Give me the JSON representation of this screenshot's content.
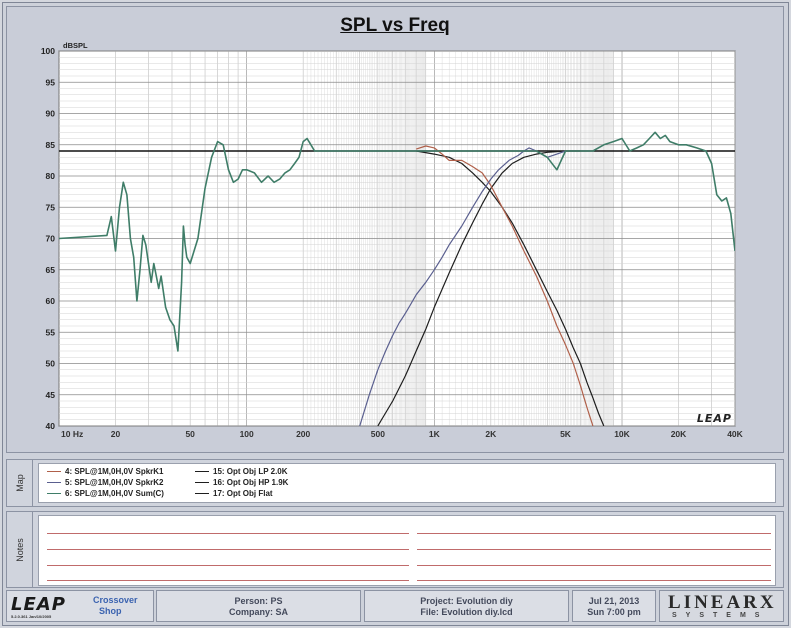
{
  "chart_data": {
    "type": "line",
    "title": "SPL vs Freq",
    "ylabel": "dBSPL",
    "xscale": "log",
    "xlim": [
      10,
      40000
    ],
    "ylim": [
      40,
      100
    ],
    "grid": true,
    "y_ticks": [
      100,
      95,
      90,
      85,
      80,
      75,
      70,
      65,
      60,
      55,
      50,
      45,
      40
    ],
    "x_ticks": [
      {
        "value": 10,
        "label": "10  Hz"
      },
      {
        "value": 20,
        "label": "20"
      },
      {
        "value": 50,
        "label": "50"
      },
      {
        "value": 100,
        "label": "100"
      },
      {
        "value": 200,
        "label": "200"
      },
      {
        "value": 500,
        "label": "500"
      },
      {
        "value": 1000,
        "label": "1K"
      },
      {
        "value": 2000,
        "label": "2K"
      },
      {
        "value": 5000,
        "label": "5K"
      },
      {
        "value": 10000,
        "label": "10K"
      },
      {
        "value": 20000,
        "label": "20K"
      },
      {
        "value": 40000,
        "label": "40K"
      }
    ],
    "reference_line": 84,
    "watermark": "LEAP",
    "series": [
      {
        "name": "4: SPL@1M,0H,0V SpkrK1",
        "color": "#b0604a",
        "x": [
          800,
          900,
          1000,
          1100,
          1200,
          1400,
          1600,
          1800,
          2000,
          2300,
          2600,
          3000,
          3500,
          4000,
          4500,
          5000,
          5500,
          6000,
          6500,
          7000
        ],
        "y": [
          84.3,
          84.8,
          84.5,
          83.5,
          82.5,
          82.5,
          81.5,
          80.5,
          78.5,
          75,
          72,
          68,
          64,
          60,
          56,
          53,
          50,
          46.5,
          43,
          40
        ]
      },
      {
        "name": "5: SPL@1M,0H,0V SpkrK2",
        "color": "#5a5f8f",
        "x": [
          400,
          450,
          500,
          550,
          600,
          650,
          700,
          800,
          900,
          1000,
          1100,
          1200,
          1400,
          1600,
          1800,
          2000,
          2200,
          2500,
          2800,
          3000,
          3200,
          3500,
          4000,
          4500,
          5000
        ],
        "y": [
          40,
          45,
          49,
          52,
          54.5,
          56.5,
          58,
          61,
          63,
          65,
          67,
          69,
          72,
          75,
          77.5,
          79.5,
          81,
          82.5,
          83.3,
          84,
          84.5,
          84,
          83,
          83.5,
          84
        ]
      },
      {
        "name": "6: SPL@1M,0H,0V Sum(C)",
        "color": "#3f7d68",
        "x": [
          10,
          18,
          19,
          20,
          21,
          22,
          23,
          24,
          25,
          26,
          27,
          28,
          29,
          30,
          31,
          32,
          33,
          34,
          35,
          37,
          39,
          41,
          43,
          45,
          46,
          47,
          48,
          50,
          55,
          60,
          65,
          70,
          75,
          80,
          85,
          90,
          95,
          100,
          110,
          120,
          130,
          140,
          150,
          160,
          170,
          180,
          190,
          200,
          210,
          220,
          230,
          250,
          300,
          400,
          500,
          700,
          1000,
          1500,
          2000,
          2500,
          3000,
          3500,
          4000,
          4500,
          5000,
          6000,
          7000,
          8000,
          9000,
          10000,
          11000,
          12000,
          13000,
          14000,
          15000,
          16000,
          17000,
          18000,
          20000,
          22000,
          25000,
          28000,
          30000,
          32000,
          34000,
          36000,
          38000,
          40000
        ],
        "y": [
          70,
          70.5,
          73.5,
          68,
          75,
          79,
          77,
          70,
          67,
          60,
          65,
          70.5,
          69,
          66,
          63,
          66,
          64,
          62,
          64,
          59,
          57,
          56,
          52,
          63,
          72,
          69,
          67,
          66,
          70,
          78,
          83,
          85.5,
          85,
          81,
          79,
          79.5,
          81,
          81,
          80.5,
          79,
          80,
          79,
          79.5,
          80.5,
          81,
          82,
          83,
          85.5,
          86,
          85,
          84,
          84,
          84,
          84,
          84,
          84,
          84,
          84,
          84,
          84,
          84,
          84,
          83,
          81,
          84,
          84,
          84,
          85,
          85.5,
          86,
          84,
          84.5,
          85,
          86,
          87,
          86,
          86.5,
          85.5,
          85,
          85,
          84.5,
          84,
          82,
          77,
          76,
          76.5,
          74,
          68
        ]
      },
      {
        "name": "15: Opt Obj LP   2.0K",
        "color": "#1e1e1e",
        "x": [
          800,
          1000,
          1200,
          1400,
          1600,
          1800,
          2000,
          2300,
          2600,
          3000,
          3500,
          4000,
          4500,
          5000,
          5500,
          6000,
          6500,
          7000,
          7500,
          8000
        ],
        "y": [
          84,
          83.5,
          83,
          82,
          80.5,
          79,
          77.5,
          75,
          72.5,
          69,
          65,
          61.5,
          58.5,
          55.5,
          52.5,
          50,
          47,
          44.5,
          42,
          40
        ]
      },
      {
        "name": "16: Opt Obj HP   1.9K",
        "color": "#1e1e1e",
        "x": [
          500,
          600,
          700,
          800,
          900,
          1000,
          1200,
          1400,
          1600,
          1800,
          2000,
          2300,
          2600,
          3000,
          3500,
          4000,
          5000,
          6000
        ],
        "y": [
          40,
          44,
          48,
          52,
          55.5,
          59,
          64.5,
          69,
          72.5,
          75.5,
          78,
          80.5,
          82,
          83,
          83.5,
          83.8,
          84,
          84
        ]
      },
      {
        "name": "17: Opt Obj Flat",
        "color": "#1e1e1e",
        "x": [],
        "y": []
      }
    ]
  },
  "map": {
    "label": "Map",
    "legend": [
      {
        "text": "4: SPL@1M,0H,0V SpkrK1",
        "color": "#b0604a"
      },
      {
        "text": "5: SPL@1M,0H,0V SpkrK2",
        "color": "#5a5f8f"
      },
      {
        "text": "6: SPL@1M,0H,0V Sum(C)",
        "color": "#3f7d68"
      },
      {
        "text": "15: Opt Obj LP    2.0K",
        "color": "#1e1e1e"
      },
      {
        "text": "16: Opt Obj HP    1.9K",
        "color": "#1e1e1e"
      },
      {
        "text": "17: Opt Obj Flat",
        "color": "#1e1e1e"
      }
    ]
  },
  "notes": {
    "label": "Notes"
  },
  "footer": {
    "logo": "LEAP",
    "version": "5.2.0.361  Jan/10/2005",
    "product_line1": "Crossover",
    "product_line2": "Shop",
    "person": "Person: PS",
    "company": "Company: SA",
    "project": "Project: Evolution diy",
    "file": "File: Evolution diy.lcd",
    "date": "Jul 21, 2013",
    "time": "Sun  7:00 pm",
    "brand": "LINEARX",
    "brand_sub": "SYSTEMS"
  }
}
